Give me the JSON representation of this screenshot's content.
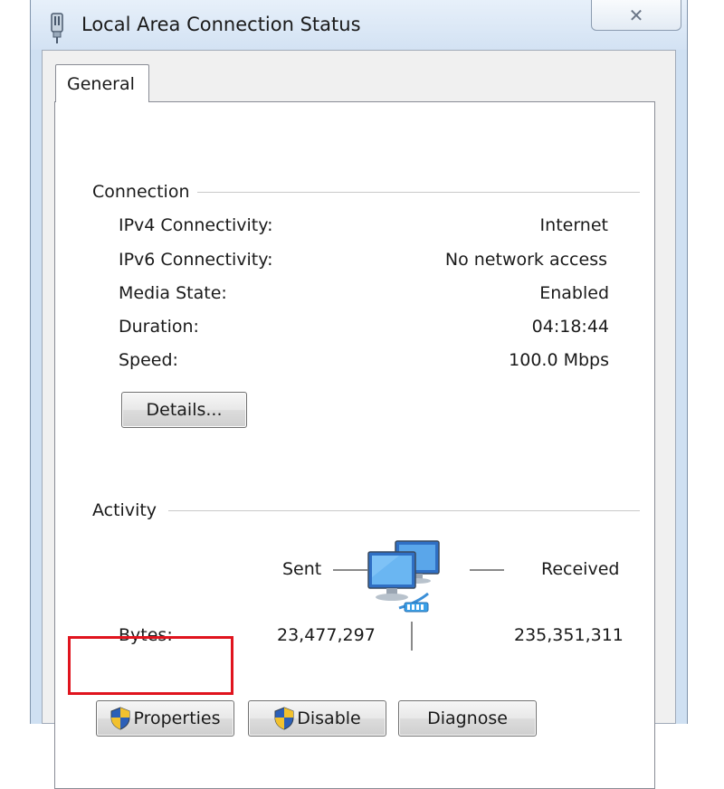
{
  "window": {
    "title": "Local Area Connection Status",
    "close_glyph": "✕",
    "title_icon": "network-adapter-icon"
  },
  "tabs": [
    {
      "label": "General",
      "selected": true
    }
  ],
  "connection": {
    "group_label": "Connection",
    "rows": [
      {
        "label": "IPv4 Connectivity:",
        "value": "Internet"
      },
      {
        "label": "IPv6 Connectivity:",
        "value": "No network access"
      },
      {
        "label": "Media State:",
        "value": "Enabled"
      },
      {
        "label": "Duration:",
        "value": "04:18:44"
      },
      {
        "label": "Speed:",
        "value": "100.0 Mbps"
      }
    ],
    "details_button": "Details..."
  },
  "activity": {
    "group_label": "Activity",
    "sent_label": "Sent",
    "received_label": "Received",
    "bytes_label": "Bytes:",
    "bytes_sent": "23,477,297",
    "bytes_received": "235,351,311",
    "icon": "network-computers-icon"
  },
  "buttons": {
    "properties": "Properties",
    "disable": "Disable",
    "diagnose": "Diagnose"
  },
  "colors": {
    "highlight": "#e0141e",
    "shield_blue": "#2b5fb8",
    "shield_yellow": "#f2c12e"
  }
}
